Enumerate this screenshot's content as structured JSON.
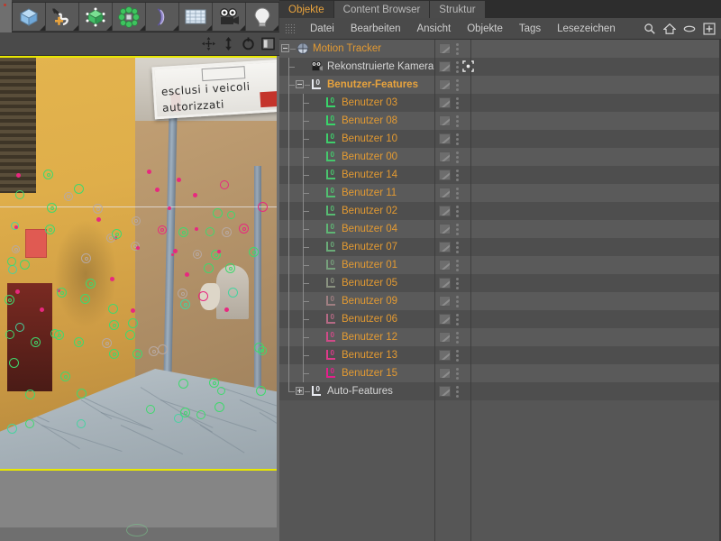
{
  "app": {
    "title": "Cinema 4D — Motion Tracker",
    "accent_orange": "#e39a32",
    "accent_green": "#49c96a",
    "accent_magenta": "#e0348a",
    "panel_bg": "#565656",
    "viewport_border": "#e8e800"
  },
  "toolbar": {
    "buttons": [
      {
        "name": "cube-icon",
        "tooltip": "Grundobjekte"
      },
      {
        "name": "spline-pen-icon",
        "tooltip": "Spline-Werkzeuge"
      },
      {
        "name": "nurbs-cube-icon",
        "tooltip": "NURBS"
      },
      {
        "name": "array-icon",
        "tooltip": "Modeling-Objekte"
      },
      {
        "name": "bend-deformer-icon",
        "tooltip": "Deformer"
      },
      {
        "name": "floor-grid-icon",
        "tooltip": "Szene-Objekte"
      },
      {
        "name": "camera-icon",
        "tooltip": "Kamera"
      },
      {
        "name": "light-bulb-icon",
        "tooltip": "Licht"
      }
    ]
  },
  "viewport": {
    "header_icons": [
      {
        "name": "move-tool-icon"
      },
      {
        "name": "scale-tool-icon"
      },
      {
        "name": "rotate-tool-icon"
      },
      {
        "name": "view-panel-icon"
      }
    ],
    "footage_text": {
      "line1": "esclusi i veicoli",
      "line2": "autorizzati"
    }
  },
  "object_manager": {
    "tabs": [
      {
        "label": "Objekte",
        "active": true
      },
      {
        "label": "Content Browser",
        "active": false
      },
      {
        "label": "Struktur",
        "active": false
      }
    ],
    "menu": [
      {
        "label": "Datei"
      },
      {
        "label": "Bearbeiten"
      },
      {
        "label": "Ansicht"
      },
      {
        "label": "Objekte"
      },
      {
        "label": "Tags"
      },
      {
        "label": "Lesezeichen"
      }
    ],
    "menu_icons": [
      {
        "name": "search-icon"
      },
      {
        "name": "home-icon"
      },
      {
        "name": "eye-icon"
      },
      {
        "name": "add-box-icon"
      }
    ],
    "tree": [
      {
        "label": "Motion Tracker",
        "depth": 0,
        "icon": "motion-tracker-icon",
        "icon_color": "#d8dce4",
        "color": "orange",
        "expander": "minus",
        "tag": false
      },
      {
        "label": "Rekonstruierte Kamera",
        "depth": 1,
        "icon": "camera-icon",
        "icon_color": "#d8d8d8",
        "color": "white",
        "expander": "none",
        "tag": true
      },
      {
        "label": "Benutzer-Features",
        "depth": 1,
        "icon": "feature-icon",
        "icon_color": "#e8eaf0",
        "color": "bold-orange",
        "expander": "minus",
        "tag": false
      },
      {
        "label": "Benutzer 03",
        "depth": 2,
        "icon": "feature-icon",
        "icon_color": "#39d46a",
        "color": "orange",
        "expander": "none",
        "tag": false
      },
      {
        "label": "Benutzer 08",
        "depth": 2,
        "icon": "feature-icon",
        "icon_color": "#39d46a",
        "color": "orange",
        "expander": "none",
        "tag": false
      },
      {
        "label": "Benutzer 10",
        "depth": 2,
        "icon": "feature-icon",
        "icon_color": "#3ece6b",
        "color": "orange",
        "expander": "none",
        "tag": false
      },
      {
        "label": "Benutzer 00",
        "depth": 2,
        "icon": "feature-icon",
        "icon_color": "#44c86c",
        "color": "orange",
        "expander": "none",
        "tag": false
      },
      {
        "label": "Benutzer 14",
        "depth": 2,
        "icon": "feature-icon",
        "icon_color": "#4ac46e",
        "color": "orange",
        "expander": "none",
        "tag": false
      },
      {
        "label": "Benutzer 11",
        "depth": 2,
        "icon": "feature-icon",
        "icon_color": "#51bf70",
        "color": "orange",
        "expander": "none",
        "tag": false
      },
      {
        "label": "Benutzer 02",
        "depth": 2,
        "icon": "feature-icon",
        "icon_color": "#57bb72",
        "color": "orange",
        "expander": "none",
        "tag": false
      },
      {
        "label": "Benutzer 04",
        "depth": 2,
        "icon": "feature-icon",
        "icon_color": "#5eb674",
        "color": "orange",
        "expander": "none",
        "tag": false
      },
      {
        "label": "Benutzer 07",
        "depth": 2,
        "icon": "feature-icon",
        "icon_color": "#6aab78",
        "color": "orange",
        "expander": "none",
        "tag": false
      },
      {
        "label": "Benutzer 01",
        "depth": 2,
        "icon": "feature-icon",
        "icon_color": "#77a07c",
        "color": "orange",
        "expander": "none",
        "tag": false
      },
      {
        "label": "Benutzer 05",
        "depth": 2,
        "icon": "feature-icon",
        "icon_color": "#8a9280",
        "color": "orange",
        "expander": "none",
        "tag": false
      },
      {
        "label": "Benutzer 09",
        "depth": 2,
        "icon": "feature-icon",
        "icon_color": "#a07f82",
        "color": "orange",
        "expander": "none",
        "tag": false
      },
      {
        "label": "Benutzer 06",
        "depth": 2,
        "icon": "feature-icon",
        "icon_color": "#b66a85",
        "color": "orange",
        "expander": "none",
        "tag": false
      },
      {
        "label": "Benutzer 12",
        "depth": 2,
        "icon": "feature-icon",
        "icon_color": "#d14a88",
        "color": "orange",
        "expander": "none",
        "tag": false
      },
      {
        "label": "Benutzer 13",
        "depth": 2,
        "icon": "feature-icon",
        "icon_color": "#dd3b8a",
        "color": "orange",
        "expander": "none",
        "tag": false
      },
      {
        "label": "Benutzer 15",
        "depth": 2,
        "icon": "feature-icon",
        "icon_color": "#e41f8c",
        "color": "orange",
        "expander": "none",
        "tag": false
      },
      {
        "label": "Auto-Features",
        "depth": 1,
        "icon": "feature-icon",
        "icon_color": "#e8eaf0",
        "color": "white",
        "expander": "plus",
        "tag": false
      }
    ]
  }
}
